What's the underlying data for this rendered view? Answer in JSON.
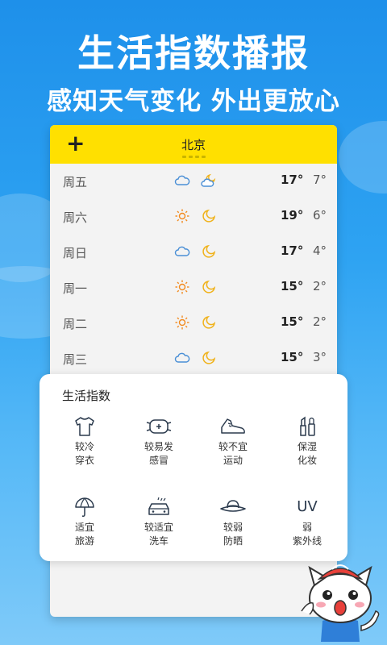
{
  "headline": {
    "title": "生活指数播报",
    "subtitle": "感知天气变化 外出更放心"
  },
  "header": {
    "add_label": "+",
    "city": "北京"
  },
  "forecast": [
    {
      "day": "周五",
      "icon1": "cloud-icon",
      "icon2": "partly-cloudy-night-icon",
      "high": "17°",
      "low": "7°"
    },
    {
      "day": "周六",
      "icon1": "sun-icon",
      "icon2": "moon-icon",
      "high": "19°",
      "low": "6°"
    },
    {
      "day": "周日",
      "icon1": "cloud-icon",
      "icon2": "moon-icon",
      "high": "17°",
      "low": "4°"
    },
    {
      "day": "周一",
      "icon1": "sun-icon",
      "icon2": "moon-icon",
      "high": "15°",
      "low": "2°"
    },
    {
      "day": "周二",
      "icon1": "sun-icon",
      "icon2": "moon-icon",
      "high": "15°",
      "low": "2°"
    },
    {
      "day": "周三",
      "icon1": "cloud-icon",
      "icon2": "moon-icon",
      "high": "15°",
      "low": "3°"
    }
  ],
  "life_index": {
    "title": "生活指数",
    "items": [
      {
        "icon": "tshirt-icon",
        "line1": "较冷",
        "line2": "穿衣"
      },
      {
        "icon": "mask-icon",
        "line1": "较易发",
        "line2": "感冒"
      },
      {
        "icon": "sneaker-icon",
        "line1": "较不宜",
        "line2": "运动"
      },
      {
        "icon": "cosmetics-icon",
        "line1": "保湿",
        "line2": "化妆"
      },
      {
        "icon": "umbrella-icon",
        "line1": "适宜",
        "line2": "旅游"
      },
      {
        "icon": "car-wash-icon",
        "line1": "较适宜",
        "line2": "洗车"
      },
      {
        "icon": "sun-hat-icon",
        "line1": "较弱",
        "line2": "防晒"
      },
      {
        "icon": "uv-icon",
        "label": "UV",
        "line1": "弱",
        "line2": "紫外线"
      }
    ]
  },
  "colors": {
    "accent_yellow": "#ffe000",
    "sky_blue": "#2ea3f2",
    "sun_orange": "#f28a1e",
    "moon_gold": "#f0b21a",
    "cloud_blue": "#4a8fd6"
  }
}
